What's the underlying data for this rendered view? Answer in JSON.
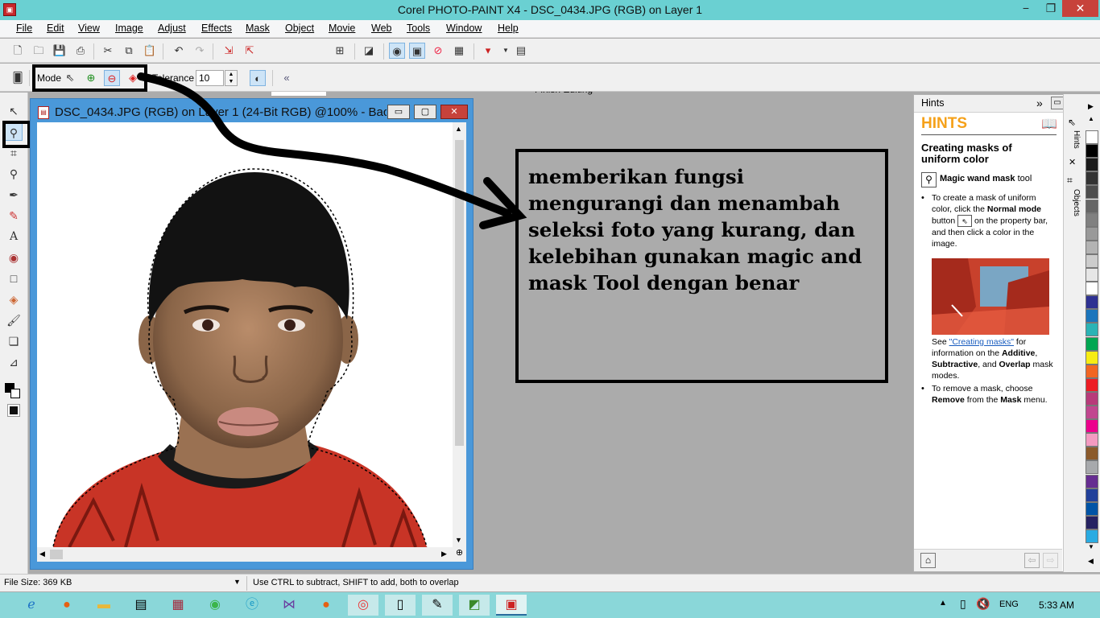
{
  "window": {
    "title": "Corel PHOTO-PAINT X4 - DSC_0434.JPG (RGB) on Layer 1",
    "minimize": "−",
    "restore": "❐",
    "close": "✕"
  },
  "menu": [
    "File",
    "Edit",
    "View",
    "Image",
    "Adjust",
    "Effects",
    "Mask",
    "Object",
    "Movie",
    "Web",
    "Tools",
    "Window",
    "Help"
  ],
  "toolbar": {
    "zoom": "100%",
    "finish_editing": "Finish Editing"
  },
  "property_bar": {
    "mode_label": "Mode",
    "tolerance_label": "Tolerance",
    "tolerance_value": "10"
  },
  "image_window": {
    "title": "DSC_0434.JPG (RGB) on Layer 1 (24-Bit RGB) @100% - Backg...",
    "minimize": "▭",
    "maximize": "▢",
    "close": "✕"
  },
  "annotation": "memberikan fungsi mengurangi dan menambah seleksi foto yang kurang, dan kelebihan gunakan magic and mask Tool dengan benar",
  "hints": {
    "panel_title": "Hints",
    "heading": "HINTS",
    "subheading": "Creating masks of uniform color",
    "tool_name": "Magic wand mask",
    "tool_suffix": " tool",
    "b1_a": "To create a mask of uniform color, click the ",
    "b1_bold": "Normal mode",
    "b1_b": "button",
    "b1_c": " on the property bar, and then click a color in the image.",
    "see": "See ",
    "link": "\"Creating masks\"",
    "see_b": " for information on the ",
    "additive": "Additive",
    "comma": ", ",
    "subtractive": "Subtractive",
    "and": ", and ",
    "overlap": "Overlap",
    "modes": " mask modes.",
    "b2_a": "To remove a mask, choose ",
    "remove": "Remove",
    "b2_b": " from the ",
    "mask": "Mask",
    "b2_c": " menu.",
    "tabs": [
      "Hints",
      "Objects"
    ]
  },
  "palette": [
    "#ffffff",
    "#000000",
    "#1a1a1a",
    "#333333",
    "#4d4d4d",
    "#666666",
    "#808080",
    "#999999",
    "#b3b3b3",
    "#cccccc",
    "#e6e6e6",
    "#ffffff",
    "#2e3192",
    "#1b75bc",
    "#2bb3b5",
    "#00a651",
    "#f7ec13",
    "#f26522",
    "#ed1c24",
    "#b83a7a",
    "#c1468f",
    "#ec008c",
    "#f49ac1",
    "#8b5a2b",
    "#a7a9ac",
    "#662d91",
    "#21409a",
    "#0054a6",
    "#262262",
    "#29abe2"
  ],
  "status": {
    "file_size": "File Size: 369 KB",
    "hint": "Use CTRL to subtract, SHIFT to add, both to overlap"
  },
  "taskbar": {
    "lang": "ENG",
    "time": "5:33 AM"
  },
  "colors": {
    "titlebar": "#6ad0d2",
    "window_frame": "#4a98d9",
    "shirt": "#d23a2a"
  }
}
